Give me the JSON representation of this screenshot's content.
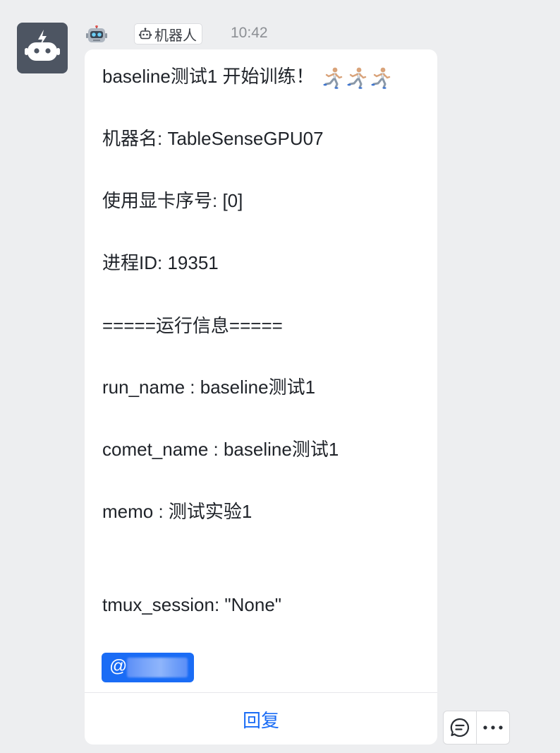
{
  "sender": {
    "avatar_icon": "robot-lightning-avatar-icon",
    "emoji_icon": "robot-face-emoji-icon",
    "bot_tag_label": "机器人",
    "time": "10:42"
  },
  "message": {
    "title_text": "baseline测试1 开始训练！",
    "title_emoji_icons": [
      "person-running-icon",
      "person-running-icon",
      "person-running-icon"
    ],
    "lines": [
      "机器名: TableSenseGPU07",
      "使用显卡序号: [0]",
      "进程ID: 19351",
      "=====运行信息=====",
      "run_name : baseline测试1",
      "comet_name : baseline测试1",
      "memo : 测试实验1",
      "tmux_session: \"None\""
    ],
    "mention_prefix": "@",
    "reply_label": "回复"
  },
  "actions": {
    "comment_icon": "comment-bubble-icon",
    "more_icon": "more-dots-icon"
  },
  "colors": {
    "background": "#edeef0",
    "avatar": "#4d5562",
    "accent": "#1a6cf5",
    "bubble": "#ffffff"
  }
}
